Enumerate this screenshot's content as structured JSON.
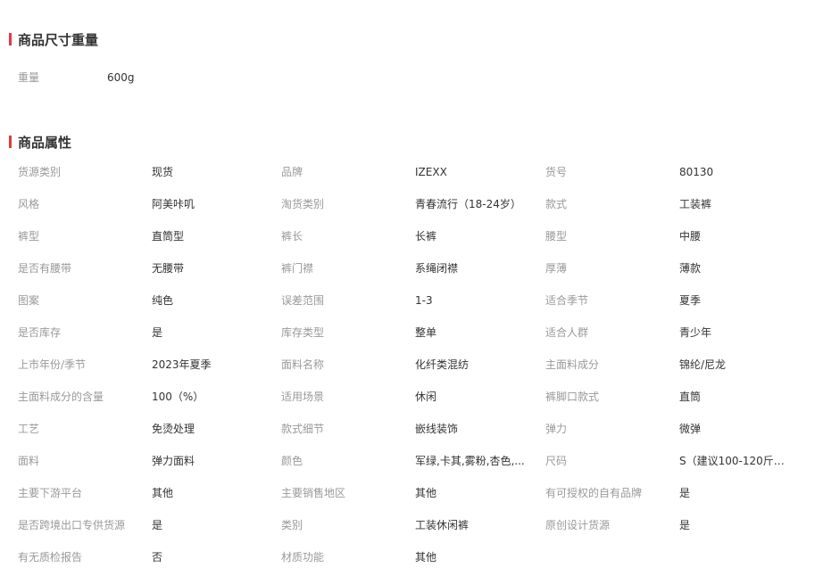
{
  "accent_color": "#e4393c",
  "size_weight": {
    "title": "商品尺寸重量",
    "weight_label": "重量",
    "weight_value": "600g"
  },
  "attributes": {
    "title": "商品属性",
    "rows": [
      [
        [
          "货源类别",
          "现货"
        ],
        [
          "品牌",
          "IZEXX"
        ],
        [
          "货号",
          "80130"
        ]
      ],
      [
        [
          "风格",
          "阿美咔叽"
        ],
        [
          "淘货类别",
          "青春流行（18-24岁）"
        ],
        [
          "款式",
          "工装裤"
        ]
      ],
      [
        [
          "裤型",
          "直筒型"
        ],
        [
          "裤长",
          "长裤"
        ],
        [
          "腰型",
          "中腰"
        ]
      ],
      [
        [
          "是否有腰带",
          "无腰带"
        ],
        [
          "裤门襟",
          "系绳闭襟"
        ],
        [
          "厚薄",
          "薄款"
        ]
      ],
      [
        [
          "图案",
          "纯色"
        ],
        [
          "误差范围",
          "1-3"
        ],
        [
          "适合季节",
          "夏季"
        ]
      ],
      [
        [
          "是否库存",
          "是"
        ],
        [
          "库存类型",
          "整单"
        ],
        [
          "适合人群",
          "青少年"
        ]
      ],
      [
        [
          "上市年份/季节",
          "2023年夏季"
        ],
        [
          "面料名称",
          "化纤类混纺"
        ],
        [
          "主面料成分",
          "锦纶/尼龙"
        ]
      ],
      [
        [
          "主面料成分的含量",
          "100（%）"
        ],
        [
          "适用场景",
          "休闲"
        ],
        [
          "裤脚口款式",
          "直筒"
        ]
      ],
      [
        [
          "工艺",
          "免烫处理"
        ],
        [
          "款式细节",
          "嵌线装饰"
        ],
        [
          "弹力",
          "微弹"
        ]
      ],
      [
        [
          "面料",
          "弹力面料"
        ],
        [
          "颜色",
          "军绿,卡其,雾粉,杏色,..."
        ],
        [
          "尺码",
          "S（建议100-120斤）,..."
        ]
      ],
      [
        [
          "主要下游平台",
          "其他"
        ],
        [
          "主要销售地区",
          "其他"
        ],
        [
          "有可授权的自有品牌",
          "是"
        ]
      ],
      [
        [
          "是否跨境出口专供货源",
          "是"
        ],
        [
          "类别",
          "工装休闲裤"
        ],
        [
          "原创设计货源",
          "是"
        ]
      ],
      [
        [
          "有无质检报告",
          "否"
        ],
        [
          "材质功能",
          "其他"
        ]
      ]
    ]
  }
}
